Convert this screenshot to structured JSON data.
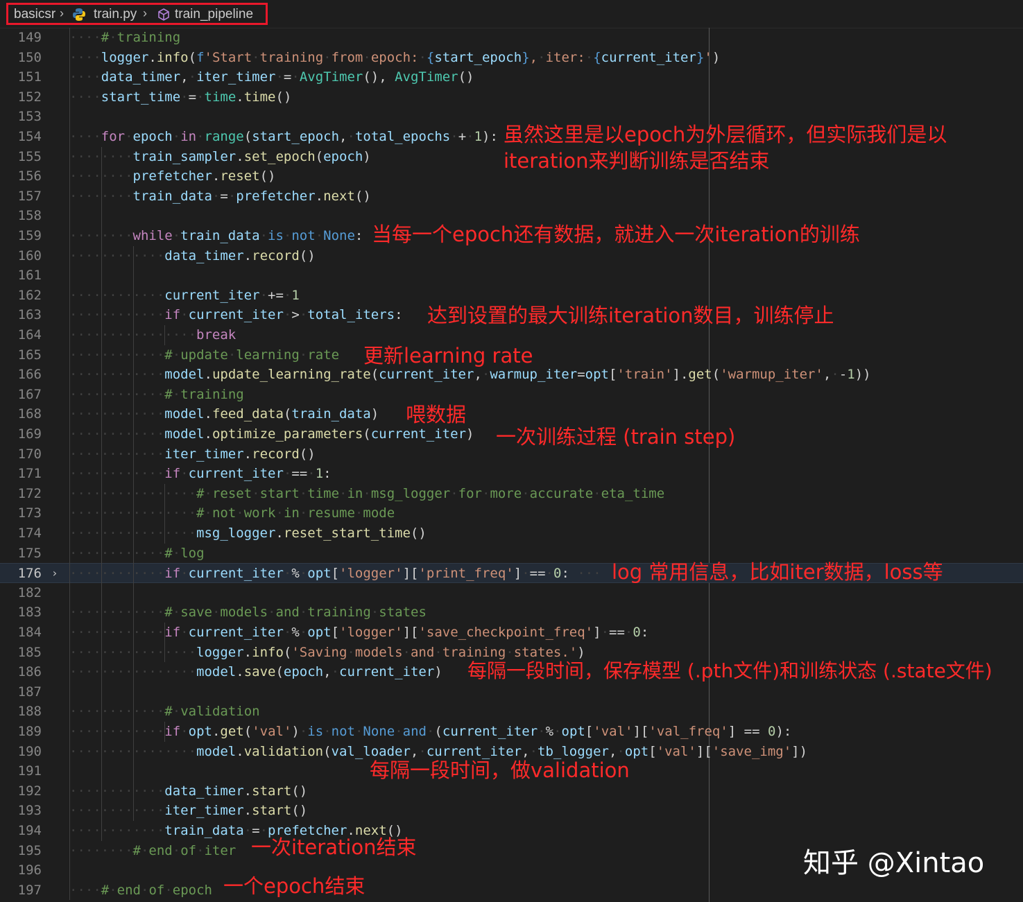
{
  "breadcrumb": {
    "folder": "basicsr",
    "file": "train.py",
    "symbol": "train_pipeline",
    "file_icon": "python-icon",
    "symbol_icon": "cube-icon"
  },
  "lines": [
    {
      "n": "149",
      "indent": 1,
      "html": "<span class='cm'># training</span>"
    },
    {
      "n": "150",
      "indent": 1,
      "html": "<span class='vr'>logger</span>.<span class='fn'>info</span>(<span class='k1'>f</span><span class='st'>'Start training from epoch: </span><span class='k1'>{</span><span class='vr'>start_epoch</span><span class='k1'>}</span><span class='st'>, iter: </span><span class='k1'>{</span><span class='vr'>current_iter</span><span class='k1'>}</span><span class='st'>'</span>)"
    },
    {
      "n": "151",
      "indent": 1,
      "html": "<span class='vr'>data_timer</span>, <span class='vr'>iter_timer</span> = <span class='cl'>AvgTimer</span>(), <span class='cl'>AvgTimer</span>()"
    },
    {
      "n": "152",
      "indent": 1,
      "html": "<span class='vr'>start_time</span> = <span class='cl'>time</span>.<span class='fn'>time</span>()"
    },
    {
      "n": "153",
      "indent": 0,
      "html": ""
    },
    {
      "n": "154",
      "indent": 1,
      "html": "<span class='k2'>for</span> <span class='vr'>epoch</span> <span class='k2'>in</span> <span class='cl'>range</span>(<span class='vr'>start_epoch</span>, <span class='vr'>total_epochs</span> + <span class='nm'>1</span>):"
    },
    {
      "n": "155",
      "indent": 2,
      "html": "<span class='vr'>train_sampler</span>.<span class='fn'>set_epoch</span>(<span class='vr'>epoch</span>)"
    },
    {
      "n": "156",
      "indent": 2,
      "html": "<span class='vr'>prefetcher</span>.<span class='fn'>reset</span>()"
    },
    {
      "n": "157",
      "indent": 2,
      "html": "<span class='vr'>train_data</span> = <span class='vr'>prefetcher</span>.<span class='fn'>next</span>()"
    },
    {
      "n": "158",
      "indent": 0,
      "html": ""
    },
    {
      "n": "159",
      "indent": 2,
      "html": "<span class='k2'>while</span> <span class='vr'>train_data</span> <span class='k1'>is</span> <span class='k1'>not</span> <span class='k1'>None</span>:"
    },
    {
      "n": "160",
      "indent": 3,
      "html": "<span class='vr'>data_timer</span>.<span class='fn'>record</span>()"
    },
    {
      "n": "161",
      "indent": 0,
      "html": ""
    },
    {
      "n": "162",
      "indent": 3,
      "html": "<span class='vr'>current_iter</span> += <span class='nm'>1</span>"
    },
    {
      "n": "163",
      "indent": 3,
      "html": "<span class='k2'>if</span> <span class='vr'>current_iter</span> &gt; <span class='vr'>total_iters</span>:"
    },
    {
      "n": "164",
      "indent": 4,
      "html": "<span class='k2'>break</span>"
    },
    {
      "n": "165",
      "indent": 3,
      "html": "<span class='cm'># update learning rate</span>"
    },
    {
      "n": "166",
      "indent": 3,
      "html": "<span class='vr'>model</span>.<span class='fn'>update_learning_rate</span>(<span class='vr'>current_iter</span>, <span class='vr'>warmup_iter</span>=<span class='vr'>opt</span>[<span class='st'>'train'</span>].<span class='fn'>get</span>(<span class='st'>'warmup_iter'</span>, -<span class='nm'>1</span>))"
    },
    {
      "n": "167",
      "indent": 3,
      "html": "<span class='cm'># training</span>"
    },
    {
      "n": "168",
      "indent": 3,
      "html": "<span class='vr'>model</span>.<span class='fn'>feed_data</span>(<span class='vr'>train_data</span>)"
    },
    {
      "n": "169",
      "indent": 3,
      "html": "<span class='vr'>model</span>.<span class='fn'>optimize_parameters</span>(<span class='vr'>current_iter</span>)"
    },
    {
      "n": "170",
      "indent": 3,
      "html": "<span class='vr'>iter_timer</span>.<span class='fn'>record</span>()"
    },
    {
      "n": "171",
      "indent": 3,
      "html": "<span class='k2'>if</span> <span class='vr'>current_iter</span> == <span class='nm'>1</span>:"
    },
    {
      "n": "172",
      "indent": 4,
      "html": "<span class='cm'># reset start time in msg_logger for more accurate eta_time</span>"
    },
    {
      "n": "173",
      "indent": 4,
      "html": "<span class='cm'># not work in resume mode</span>"
    },
    {
      "n": "174",
      "indent": 4,
      "html": "<span class='vr'>msg_logger</span>.<span class='fn'>reset_start_time</span>()"
    },
    {
      "n": "175",
      "indent": 3,
      "html": "<span class='cm'># log</span>"
    },
    {
      "n": "176",
      "indent": 3,
      "current": true,
      "html": "<span class='k2'>if</span> <span class='vr'>current_iter</span> % <span class='vr'>opt</span>[<span class='st'>'logger'</span>][<span class='st'>'print_freq'</span>] == <span class='nm'>0</span>: <span class='ws'>···</span>"
    },
    {
      "n": "182",
      "indent": 0,
      "html": ""
    },
    {
      "n": "183",
      "indent": 3,
      "html": "<span class='cm'># save models and training states</span>"
    },
    {
      "n": "184",
      "indent": 3,
      "html": "<span class='k2'>if</span> <span class='vr'>current_iter</span> % <span class='vr'>opt</span>[<span class='st'>'logger'</span>][<span class='st'>'save_checkpoint_freq'</span>] == <span class='nm'>0</span>:"
    },
    {
      "n": "185",
      "indent": 4,
      "html": "<span class='vr'>logger</span>.<span class='fn'>info</span>(<span class='st'>'Saving models and training states.'</span>)"
    },
    {
      "n": "186",
      "indent": 4,
      "html": "<span class='vr'>model</span>.<span class='fn'>save</span>(<span class='vr'>epoch</span>, <span class='vr'>current_iter</span>)"
    },
    {
      "n": "187",
      "indent": 0,
      "html": ""
    },
    {
      "n": "188",
      "indent": 3,
      "html": "<span class='cm'># validation</span>"
    },
    {
      "n": "189",
      "indent": 3,
      "html": "<span class='k2'>if</span> <span class='vr'>opt</span>.<span class='fn'>get</span>(<span class='st'>'val'</span>) <span class='k1'>is</span> <span class='k1'>not</span> <span class='k1'>None</span> <span class='k1'>and</span> (<span class='vr'>current_iter</span> % <span class='vr'>opt</span>[<span class='st'>'val'</span>][<span class='st'>'val_freq'</span>] == <span class='nm'>0</span>):"
    },
    {
      "n": "190",
      "indent": 4,
      "html": "<span class='vr'>model</span>.<span class='fn'>validation</span>(<span class='vr'>val_loader</span>, <span class='vr'>current_iter</span>, <span class='vr'>tb_logger</span>, <span class='vr'>opt</span>[<span class='st'>'val'</span>][<span class='st'>'save_img'</span>])"
    },
    {
      "n": "191",
      "indent": 0,
      "html": ""
    },
    {
      "n": "192",
      "indent": 3,
      "html": "<span class='vr'>data_timer</span>.<span class='fn'>start</span>()"
    },
    {
      "n": "193",
      "indent": 3,
      "html": "<span class='vr'>iter_timer</span>.<span class='fn'>start</span>()"
    },
    {
      "n": "194",
      "indent": 3,
      "html": "<span class='vr'>train_data</span> = <span class='vr'>prefetcher</span>.<span class='fn'>next</span>()"
    },
    {
      "n": "195",
      "indent": 2,
      "html": "<span class='cm'># end of iter</span>"
    },
    {
      "n": "196",
      "indent": 0,
      "html": ""
    },
    {
      "n": "197",
      "indent": 1,
      "html": "<span class='cm'># end of epoch</span>"
    }
  ],
  "annotations": {
    "epoch_loop": "虽然这里是以epoch为外层循环，但实际我们是以",
    "epoch_loop_2": "iteration来判断训练是否结束",
    "while_loop": "当每一个epoch还有数据，就进入一次iteration的训练",
    "max_iter": "达到设置的最大训练iteration数目，训练停止",
    "update_lr": "更新learning rate",
    "feed": "喂数据",
    "train_step": "一次训练过程 (train step)",
    "log": "log 常用信息，比如iter数据，loss等",
    "save": "每隔一段时间，保存模型 (.pth文件)和训练状态 (.state文件)",
    "validation": "每隔一段时间，做validation",
    "end_iter": "一次iteration结束",
    "end_epoch": "一个epoch结束"
  },
  "watermark": "知乎 @Xintao",
  "colors": {
    "background": "#1e1e1e",
    "annotation": "#ff2a2a",
    "highlight_box": "#e8182b"
  }
}
